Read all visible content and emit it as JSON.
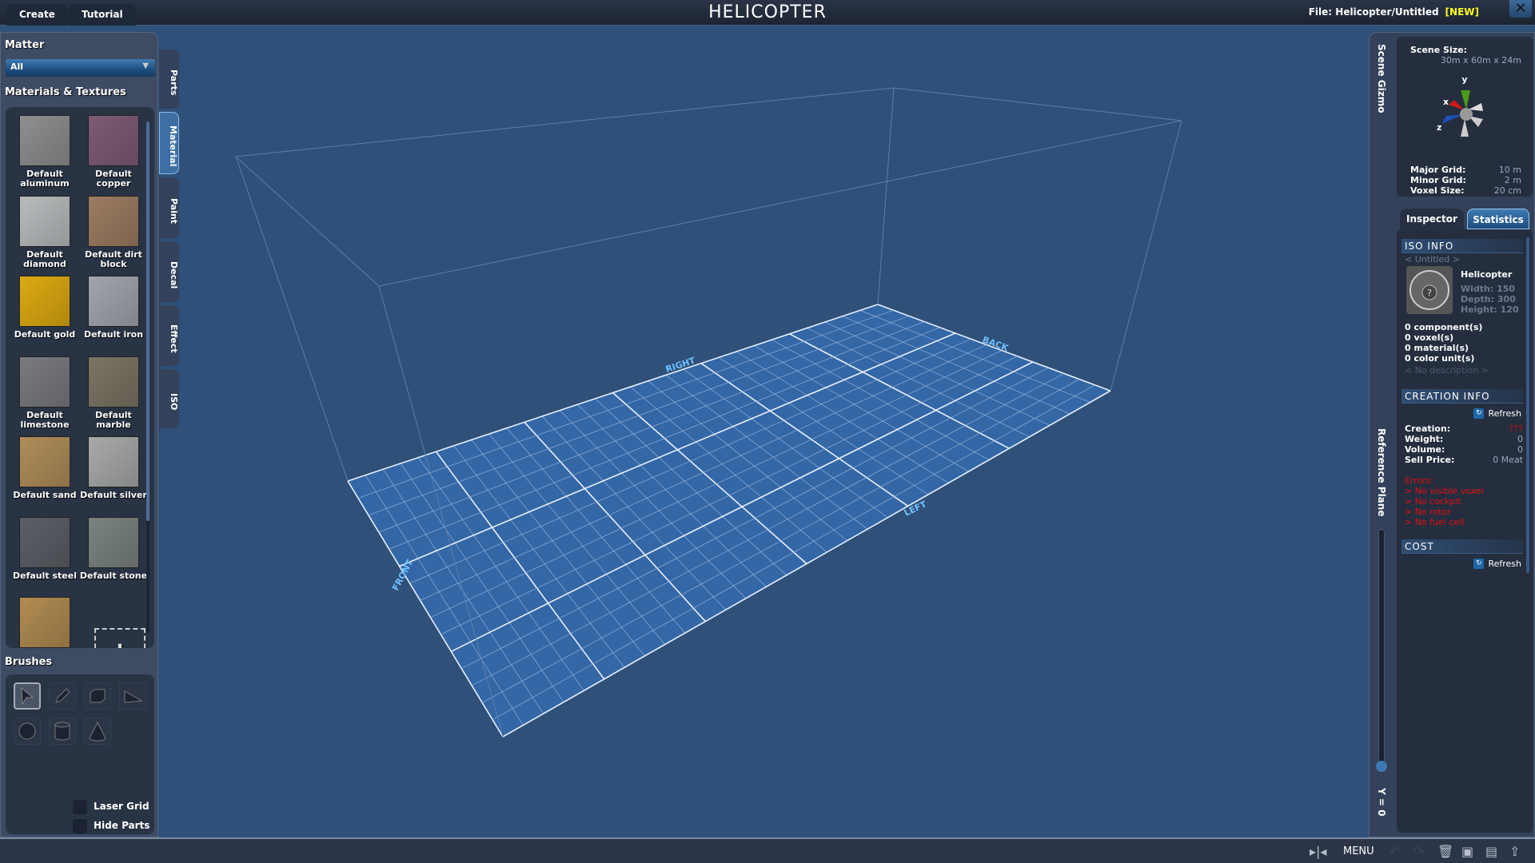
{
  "topbar": {
    "tabs": [
      "Create",
      "Tutorial"
    ],
    "title": "HELICOPTER",
    "file_label": "File:",
    "file_path": "Helicopter/Untitled",
    "file_status": "[NEW]"
  },
  "left": {
    "matter_label": "Matter",
    "matter_select": "All",
    "materials_label": "Materials & Textures",
    "materials": [
      {
        "name": "Default aluminum",
        "color": "#8d8f90"
      },
      {
        "name": "Default copper",
        "color": "#7e5b76"
      },
      {
        "name": "Default diamond",
        "color": "#b8bcbd"
      },
      {
        "name": "Default dirt block",
        "color": "#9c7c62"
      },
      {
        "name": "Default gold",
        "color": "#dcaa12"
      },
      {
        "name": "Default iron",
        "color": "#a3a5ad"
      },
      {
        "name": "Default limestone",
        "color": "#7a7b80"
      },
      {
        "name": "Default marble",
        "color": "#7b7565"
      },
      {
        "name": "Default sand",
        "color": "#b08e5a"
      },
      {
        "name": "Default silver",
        "color": "#a8aaa9"
      },
      {
        "name": "Default steel",
        "color": "#5c5f66"
      },
      {
        "name": "Default stone",
        "color": "#7b8480"
      },
      {
        "name": "",
        "color": "#b18c52"
      }
    ],
    "brushes_label": "Brushes",
    "laser_grid": "Laser Grid",
    "hide_parts": "Hide Parts"
  },
  "side_tabs": [
    "Parts",
    "Material",
    "Paint",
    "Decal",
    "Effect",
    "ISO"
  ],
  "viewport": {
    "labels": [
      "FRONT",
      "LEFT",
      "RIGHT",
      "BACK"
    ]
  },
  "right": {
    "scene_gizmo": "Scene Gizmo",
    "scene_size_label": "Scene Size:",
    "scene_size": "30m x 60m x 24m",
    "axes": [
      "x",
      "y",
      "z"
    ],
    "major_grid_label": "Major Grid:",
    "major_grid": "10 m",
    "minor_grid_label": "Minor Grid:",
    "minor_grid": "2 m",
    "voxel_size_label": "Voxel Size:",
    "voxel_size": "20 cm",
    "tabs": [
      "Inspector",
      "Statistics"
    ],
    "iso_info": "ISO INFO",
    "iso_name": "< Untitled >",
    "iso_type": "Helicopter",
    "width": "Width: 150",
    "depth": "Depth: 300",
    "height": "Height: 120",
    "counts": [
      "0 component(s)",
      "0 voxel(s)",
      "0 material(s)",
      "0 color unit(s)"
    ],
    "description": "< No description >",
    "creation_info": "CREATION INFO",
    "refresh": "Refresh",
    "stats": [
      {
        "k": "Creation:",
        "v": "???"
      },
      {
        "k": "Weight:",
        "v": "0"
      },
      {
        "k": "Volume:",
        "v": "0"
      },
      {
        "k": "Sell Price:",
        "v": "0 Meat"
      }
    ],
    "errors_label": "Errors:",
    "errors": [
      "> No visible voxel",
      "> No cockpit",
      "> No rotor",
      "> No fuel cell"
    ],
    "cost": "COST",
    "reference_plane": "Reference Plane",
    "y_value": "Y = 0",
    "reference_plane_level": 0
  },
  "bottombar": {
    "menu": "MENU"
  }
}
